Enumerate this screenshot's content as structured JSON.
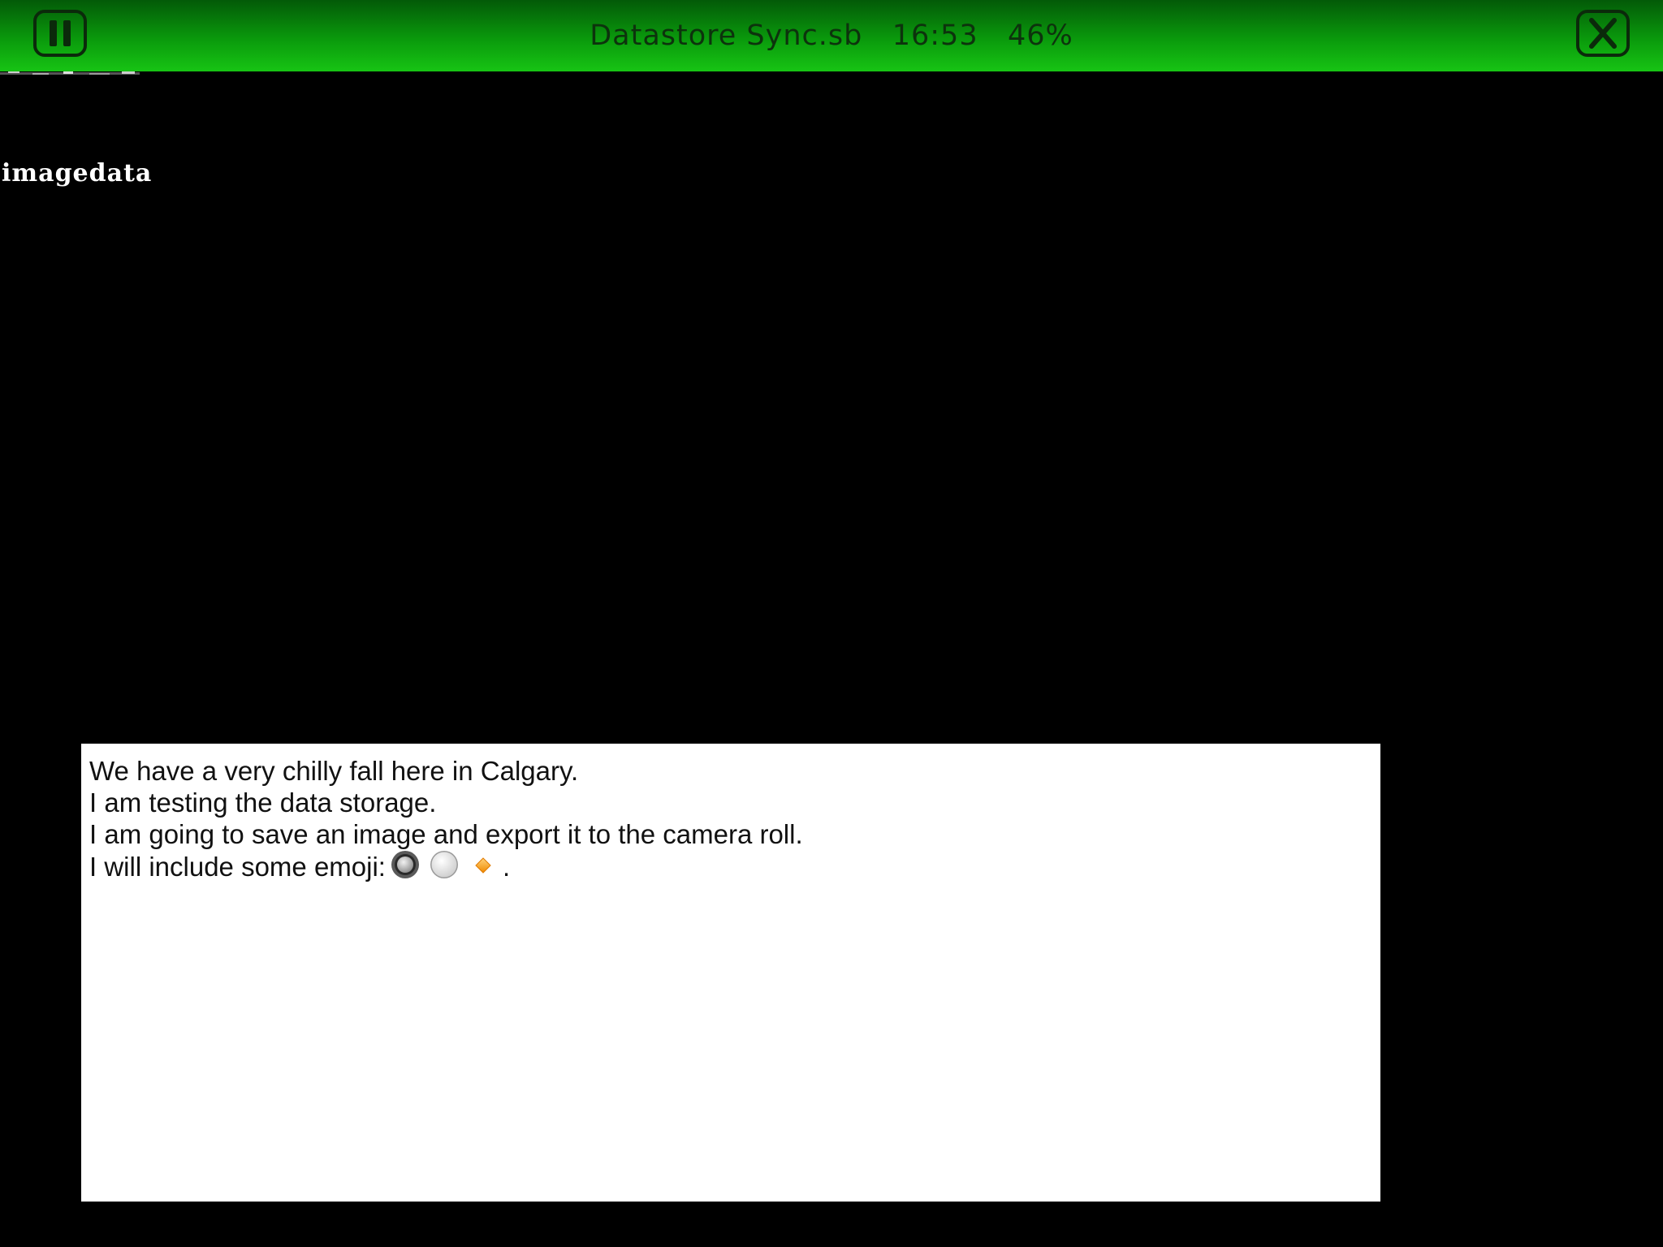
{
  "header": {
    "title": "Datastore Sync.sb   16:53   46%",
    "pause_icon": "pause-icon",
    "close_icon": "close-icon",
    "bar_color_top": "#035a08",
    "bar_color_bottom": "#17c414"
  },
  "canvas": {
    "label": "imagedata",
    "background": "#000000"
  },
  "textview": {
    "lines": [
      "We have a very chilly fall here in Calgary.",
      "I am testing the data storage.",
      "I am going to save an image and export it to the camera roll.",
      "I will include some emoji:"
    ],
    "trailing": ".",
    "emoji_icons": [
      "radio-selected-icon",
      "radio-unselected-icon",
      "orange-diamond-icon"
    ]
  }
}
